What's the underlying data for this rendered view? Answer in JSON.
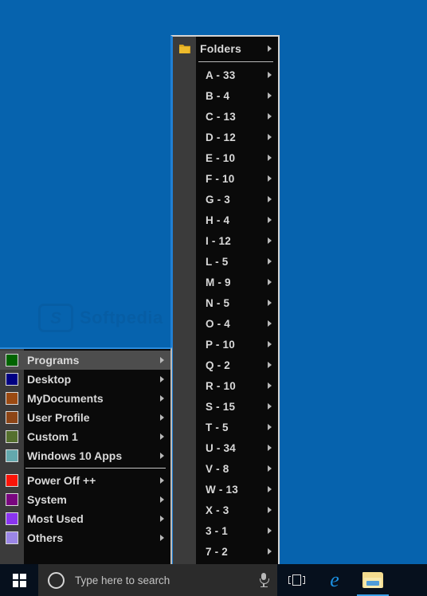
{
  "desktop": {
    "background_color": "#0663ae",
    "watermark_mark": "S",
    "watermark_text": "Softpedia"
  },
  "main_menu": {
    "name": "Classic Shell main menu",
    "selected_item": "Programs",
    "items": [
      {
        "label": "Programs",
        "icon": "folder-swatch-icon",
        "color": "#006400",
        "selected": true,
        "has_submenu": true
      },
      {
        "label": "Desktop",
        "icon": "folder-swatch-icon",
        "color": "#000082",
        "selected": false,
        "has_submenu": true
      },
      {
        "label": "MyDocuments",
        "icon": "folder-swatch-icon",
        "color": "#9b4a12",
        "selected": false,
        "has_submenu": true
      },
      {
        "label": "User Profile",
        "icon": "folder-swatch-icon",
        "color": "#8d4516",
        "selected": false,
        "has_submenu": true
      },
      {
        "label": "Custom 1",
        "icon": "folder-swatch-icon",
        "color": "#55702e",
        "selected": false,
        "has_submenu": true
      },
      {
        "label": "Windows 10 Apps",
        "icon": "folder-swatch-icon",
        "color": "#63a8ad",
        "selected": false,
        "has_submenu": true
      },
      {
        "separator": true
      },
      {
        "label": "Power Off ++",
        "icon": "folder-swatch-icon",
        "color": "#fa1408",
        "selected": false,
        "has_submenu": true
      },
      {
        "label": "System",
        "icon": "folder-swatch-icon",
        "color": "#79067f",
        "selected": false,
        "has_submenu": true
      },
      {
        "label": "Most Used",
        "icon": "folder-swatch-icon",
        "color": "#8a34ef",
        "selected": false,
        "has_submenu": true
      },
      {
        "label": "Others",
        "icon": "folder-swatch-icon",
        "color": "#9b86e6",
        "selected": false,
        "has_submenu": true
      }
    ]
  },
  "folders_menu": {
    "name": "Folders submenu",
    "header": {
      "label": "Folders",
      "icon": "folder-icon",
      "has_submenu": true
    },
    "items": [
      {
        "label": "A - 33",
        "has_submenu": true
      },
      {
        "label": "B - 4",
        "has_submenu": true
      },
      {
        "label": "C - 13",
        "has_submenu": true
      },
      {
        "label": "D - 12",
        "has_submenu": true
      },
      {
        "label": "E - 10",
        "has_submenu": true
      },
      {
        "label": "F - 10",
        "has_submenu": true
      },
      {
        "label": "G - 3",
        "has_submenu": true
      },
      {
        "label": "H - 4",
        "has_submenu": true
      },
      {
        "label": "I - 12",
        "has_submenu": true
      },
      {
        "label": "L - 5",
        "has_submenu": true
      },
      {
        "label": "M - 9",
        "has_submenu": true
      },
      {
        "label": "N - 5",
        "has_submenu": true
      },
      {
        "label": "O - 4",
        "has_submenu": true
      },
      {
        "label": "P - 10",
        "has_submenu": true
      },
      {
        "label": "Q - 2",
        "has_submenu": true
      },
      {
        "label": "R - 10",
        "has_submenu": true
      },
      {
        "label": "S - 15",
        "has_submenu": true
      },
      {
        "label": "T - 5",
        "has_submenu": true
      },
      {
        "label": "U - 34",
        "has_submenu": true
      },
      {
        "label": "V - 8",
        "has_submenu": true
      },
      {
        "label": "W - 13",
        "has_submenu": true
      },
      {
        "label": "X - 3",
        "has_submenu": true
      },
      {
        "label": "3 - 1",
        "has_submenu": true
      },
      {
        "label": "7 - 2",
        "has_submenu": true
      }
    ]
  },
  "taskbar": {
    "start_button": "start-button",
    "search": {
      "icon": "cortana-circle-icon",
      "placeholder": "Type here to search",
      "value": "",
      "mic_icon": "microphone-icon"
    },
    "buttons": [
      {
        "name": "task-view-button",
        "icon": "task-view-icon"
      },
      {
        "name": "edge-button",
        "icon": "edge-browser-icon",
        "glyph": "e"
      },
      {
        "name": "file-explorer-button",
        "icon": "file-explorer-icon",
        "active": true
      }
    ]
  }
}
